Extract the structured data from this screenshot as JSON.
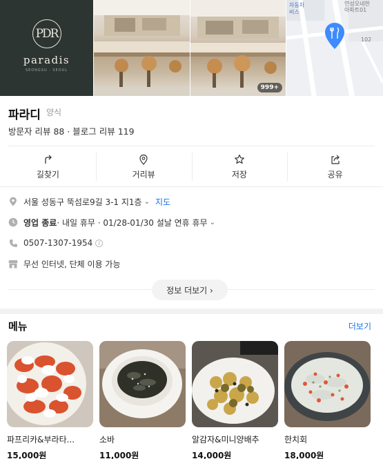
{
  "photos": {
    "logo_text": "paradis",
    "logo_monogram": "PDR",
    "logo_sub": "SEONGSU · SEOUL",
    "more_count": "999+",
    "map_labels": [
      "자동차",
      "비스",
      "연성오네한",
      "아파트01",
      "102"
    ]
  },
  "place": {
    "name": "파라디",
    "category": "양식",
    "reviews": "방문자 리뷰 88 · 블로그 리뷰 119"
  },
  "actions": [
    {
      "label": "길찾기",
      "icon": "directions-icon"
    },
    {
      "label": "거리뷰",
      "icon": "location-pin-icon"
    },
    {
      "label": "저장",
      "icon": "star-icon"
    },
    {
      "label": "공유",
      "icon": "share-icon"
    }
  ],
  "info": {
    "address": "서울 성동구 뚝섬로9길 3-1 지1층",
    "map_link": "지도",
    "status": "영업 종료",
    "hours_detail": " · 내일 휴무 · 01/28-01/30 설날 연휴 휴무",
    "phone": "0507-1307-1954",
    "facilities": "무선 인터넷, 단체 이용 가능",
    "more_button": "정보 더보기 ›"
  },
  "menu": {
    "title": "메뉴",
    "more": "더보기",
    "items": [
      {
        "name": "파프리카&부라타...",
        "price": "15,000원"
      },
      {
        "name": "소바",
        "price": "11,000원"
      },
      {
        "name": "알감자&미니양배추",
        "price": "14,000원"
      },
      {
        "name": "한치회",
        "price": "18,000원"
      }
    ]
  },
  "colors": {
    "accent": "#1a73e8",
    "logo_bg": "#2d3532",
    "map_pin": "#3d8bfd"
  }
}
